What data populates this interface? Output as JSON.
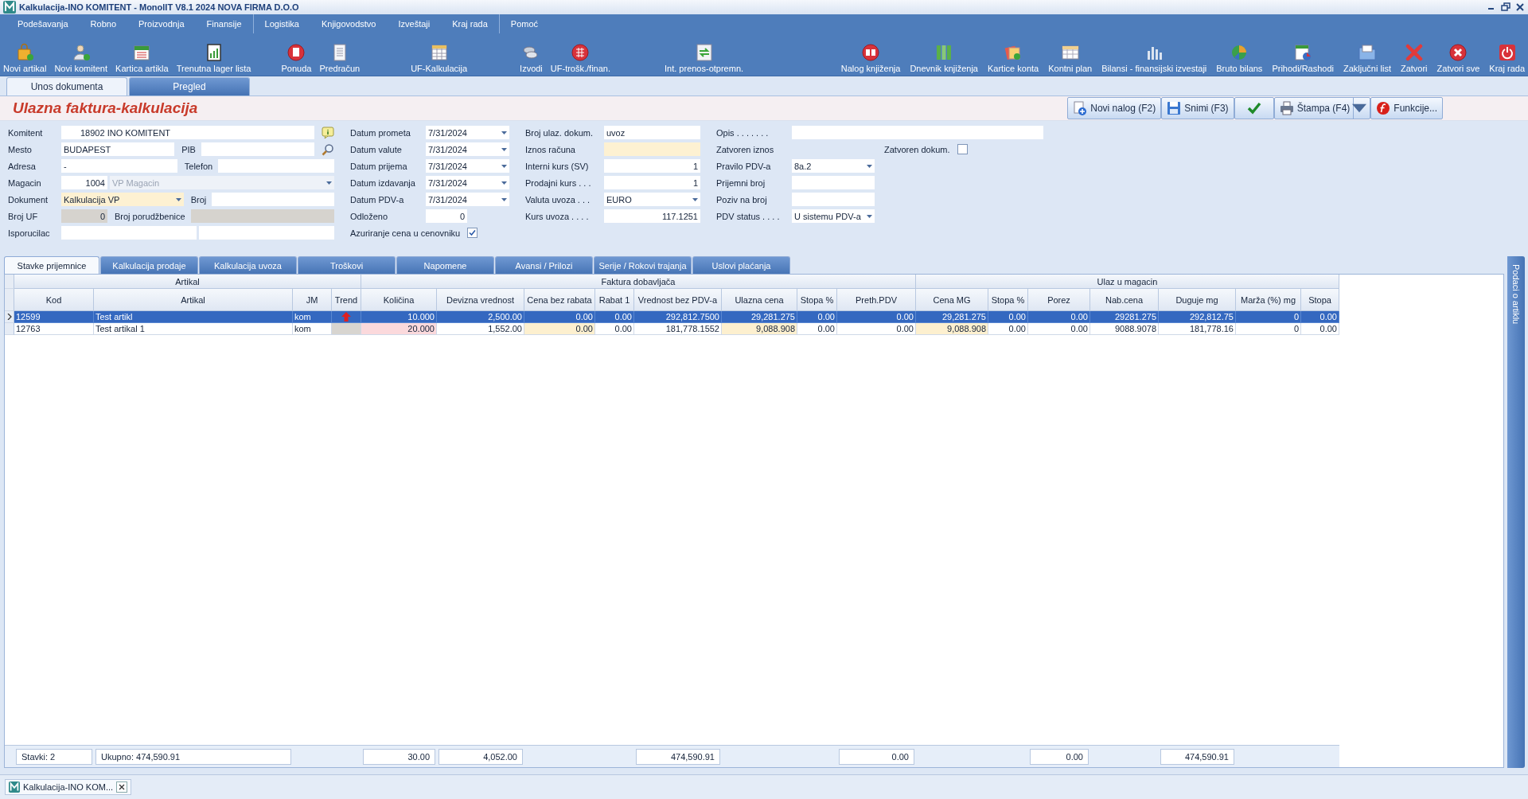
{
  "window": {
    "title": "Kalkulacija-INO KOMITENT - MonolIT V8.1 2024 NOVA FIRMA D.O.O"
  },
  "menu": [
    [
      "Podešavanja",
      "Robno",
      "Proizvodnja",
      "Finansije"
    ],
    [
      "Logistika",
      "Knjigovodstvo",
      "Izveštaji",
      "Kraj rada"
    ],
    [
      "Pomoć"
    ]
  ],
  "toolbar": [
    [
      "Novi artikal",
      "Novi komitent",
      "Kartica artikla",
      "Trenutna lager lista"
    ],
    [
      "Ponuda",
      "Predračun"
    ],
    [
      "UF-Kalkulacija"
    ],
    [
      "Izvodi",
      "UF-trošk./finan."
    ],
    [
      "Int. prenos-otpremn."
    ],
    [
      "Nalog knjiženja",
      "Dnevnik knjiženja",
      "Kartice konta",
      "Kontni plan",
      "Bilansi - finansijski izvestaji",
      "Bruto bilans",
      "Prihodi/Rashodi",
      "Zaključni list",
      "Zatvori",
      "Zatvori sve",
      "Kraj rada"
    ]
  ],
  "tabs": [
    {
      "label": "Unos dokumenta",
      "selected": true
    },
    {
      "label": "Pregled",
      "selected": false
    }
  ],
  "form_title": "Ulazna faktura-kalkulacija",
  "actions": [
    {
      "kind": "new",
      "label": "Novi nalog (F2)"
    },
    {
      "kind": "save",
      "label": "Snimi (F3)"
    },
    {
      "kind": "confirm"
    },
    {
      "kind": "print",
      "label": "Štampa (F4)"
    },
    {
      "kind": "functions",
      "label": "Funkcije..."
    }
  ],
  "form": [
    [
      [
        {
          "kind": "label",
          "text": "Komitent"
        },
        {
          "kind": "input",
          "value": "18902 INO KOMITENT"
        }
      ],
      [
        {
          "kind": "label",
          "text": "Mesto"
        },
        {
          "kind": "input",
          "value": "BUDAPEST"
        },
        {
          "kind": "label",
          "text": "PIB"
        },
        {
          "kind": "input"
        }
      ],
      [
        {
          "kind": "label",
          "text": "Adresa"
        },
        {
          "kind": "input",
          "value": "-"
        },
        {
          "kind": "label",
          "text": "Telefon"
        },
        {
          "kind": "input"
        }
      ],
      [
        {
          "kind": "label",
          "text": "Magacin"
        },
        {
          "kind": "number",
          "value": "1004"
        },
        {
          "kind": "dropdown",
          "value": "VP Magacin",
          "disabled": true
        }
      ],
      [
        {
          "kind": "label",
          "text": "Dokument"
        },
        {
          "kind": "dropdown",
          "value": "Kalkulacija VP",
          "color": "#fdf1d2"
        },
        {
          "kind": "label",
          "text": "Broj"
        },
        {
          "kind": "input"
        }
      ],
      [
        {
          "kind": "label",
          "text": "Broj UF"
        },
        {
          "kind": "number",
          "value": "0",
          "color": "#d6d3ce"
        },
        {
          "kind": "label",
          "text": "Broj porudžbenice"
        },
        {
          "kind": "input",
          "color": "#d6d3ce"
        }
      ],
      [
        {
          "kind": "label",
          "text": "Isporucilac"
        },
        {
          "kind": "input"
        },
        {
          "kind": "input"
        }
      ]
    ],
    [
      [
        {
          "kind": "label",
          "text": "Datum prometa"
        },
        {
          "kind": "dropdown",
          "value": "7/31/2024"
        }
      ],
      [
        {
          "kind": "label",
          "text": "Datum valute"
        },
        {
          "kind": "dropdown",
          "value": "7/31/2024"
        }
      ],
      [
        {
          "kind": "label",
          "text": "Datum prijema"
        },
        {
          "kind": "dropdown",
          "value": "7/31/2024"
        }
      ],
      [
        {
          "kind": "label",
          "text": "Datum izdavanja"
        },
        {
          "kind": "dropdown",
          "value": "7/31/2024"
        }
      ],
      [
        {
          "kind": "label",
          "text": "Datum PDV-a"
        },
        {
          "kind": "dropdown",
          "value": "7/31/2024"
        }
      ],
      [
        {
          "kind": "label",
          "text": "Odloženo"
        },
        {
          "kind": "number",
          "value": "0"
        }
      ],
      [
        {
          "kind": "label",
          "text": "Azuriranje cena u cenovniku"
        },
        {
          "kind": "checkbox",
          "checked": true
        }
      ]
    ],
    [
      [
        {
          "kind": "label",
          "text": "Broj ulaz. dokum."
        },
        {
          "kind": "input",
          "value": "uvoz"
        }
      ],
      [
        {
          "kind": "label",
          "text": "Iznos računa"
        },
        {
          "kind": "input",
          "color": "#fdf1d2"
        }
      ],
      [
        {
          "kind": "label",
          "text": "Interni kurs (SV)"
        },
        {
          "kind": "number",
          "value": "1"
        }
      ],
      [
        {
          "kind": "label",
          "text": "Prodajni kurs . . ."
        },
        {
          "kind": "number",
          "value": "1"
        }
      ],
      [
        {
          "kind": "label",
          "text": "Valuta uvoza . . ."
        },
        {
          "kind": "dropdown",
          "value": "EURO"
        }
      ],
      [
        {
          "kind": "label",
          "text": "Kurs uvoza . . . ."
        },
        {
          "kind": "number",
          "value": "117.1251"
        }
      ]
    ],
    [
      [
        {
          "kind": "label",
          "text": "Opis . . . . . . ."
        },
        {
          "kind": "input"
        }
      ],
      [
        {
          "kind": "label",
          "text": "Zatvoren iznos"
        },
        {
          "kind": "label",
          "text": "Zatvoren dokum."
        },
        {
          "kind": "checkbox",
          "checked": false
        }
      ],
      [
        {
          "kind": "label",
          "text": "Pravilo PDV-a"
        },
        {
          "kind": "dropdown",
          "value": "8a.2"
        }
      ],
      [
        {
          "kind": "label",
          "text": "Prijemni broj"
        },
        {
          "kind": "input"
        }
      ],
      [
        {
          "kind": "label",
          "text": "Poziv na broj"
        },
        {
          "kind": "input"
        }
      ],
      [
        {
          "kind": "label",
          "text": "PDV status . . . ."
        },
        {
          "kind": "dropdown",
          "value": "U sistemu PDV-a"
        }
      ]
    ]
  ],
  "detail_tabs": [
    {
      "label": "Stavke  prijemnice",
      "selected": true
    },
    {
      "label": "Kalkulacija prodaje",
      "selected": false
    },
    {
      "label": "Kalkulacija uvoza",
      "selected": false
    },
    {
      "label": "Troškovi",
      "selected": false
    },
    {
      "label": "Napomene",
      "selected": false
    },
    {
      "label": "Avansi / Prilozi",
      "selected": false
    },
    {
      "label": "Serije / Rokovi trajanja",
      "selected": false
    },
    {
      "label": "Uslovi plaćanja",
      "selected": false
    }
  ],
  "column_groups": [
    "Artikal",
    "Faktura dobavljača",
    "Ulaz u magacin"
  ],
  "columns": [
    {
      "label": "Kod",
      "kind": "text"
    },
    {
      "label": "Artikal",
      "kind": "text"
    },
    {
      "label": "JM",
      "kind": "text"
    },
    {
      "label": "Trend",
      "kind": "trend"
    },
    {
      "label": "Količina",
      "kind": "number",
      "color": "#fbd9dc"
    },
    {
      "label": "Devizna vrednost",
      "kind": "number"
    },
    {
      "label": "Cena bez rabata",
      "kind": "number",
      "color": "#fdf0cf"
    },
    {
      "label": "Rabat 1",
      "kind": "number"
    },
    {
      "label": "Vrednost bez PDV-a",
      "kind": "number"
    },
    {
      "label": "Ulazna cena",
      "kind": "number",
      "color": "#fdf0cf"
    },
    {
      "label": "Stopa %",
      "kind": "number"
    },
    {
      "label": "Preth.PDV",
      "kind": "number"
    },
    {
      "label": "Cena MG",
      "kind": "number",
      "color": "#fdf0cf"
    },
    {
      "label": "Stopa %",
      "kind": "number"
    },
    {
      "label": "Porez",
      "kind": "number"
    },
    {
      "label": "Nab.cena",
      "kind": "number"
    },
    {
      "label": "Duguje mg",
      "kind": "number"
    },
    {
      "label": "Marža (%) mg",
      "kind": "number"
    },
    {
      "label": "Stopa",
      "kind": "number"
    }
  ],
  "rows": [
    {
      "selected": true,
      "trend_up": true,
      "cells": [
        "12599",
        "Test artikl",
        "kom",
        "10.000",
        "2,500.00",
        "0.00",
        "0.00",
        "292,812.7500",
        "29,281.275",
        "0.00",
        "0.00",
        "29,281.275",
        "0.00",
        "0.00",
        "29281.275",
        "292,812.75",
        "0",
        "0.00"
      ]
    },
    {
      "selected": false,
      "trend_up": false,
      "cells": [
        "12763",
        "Test artikal 1",
        "kom",
        "20.000",
        "1,552.00",
        "0.00",
        "0.00",
        "181,778.1552",
        "9,088.908",
        "0.00",
        "0.00",
        "9,088.908",
        "0.00",
        "0.00",
        "9088.9078",
        "181,778.16",
        "0",
        "0.00"
      ]
    }
  ],
  "footer": [
    {
      "kind": "label",
      "text": "Stavki: 2"
    },
    {
      "kind": "label",
      "text": "Ukupno:  474,590.91"
    },
    {
      "kind": "total",
      "text": "30.00"
    },
    {
      "kind": "total",
      "text": "4,052.00"
    },
    {
      "kind": "total",
      "text": "474,590.91"
    },
    {
      "kind": "total",
      "text": "0.00"
    },
    {
      "kind": "total",
      "text": "0.00"
    },
    {
      "kind": "total",
      "text": "474,590.91"
    }
  ],
  "side_tab": "Podaci o artiklu",
  "taskbar": [
    {
      "label": "Kalkulacija-INO KOM...",
      "selected": true
    }
  ]
}
